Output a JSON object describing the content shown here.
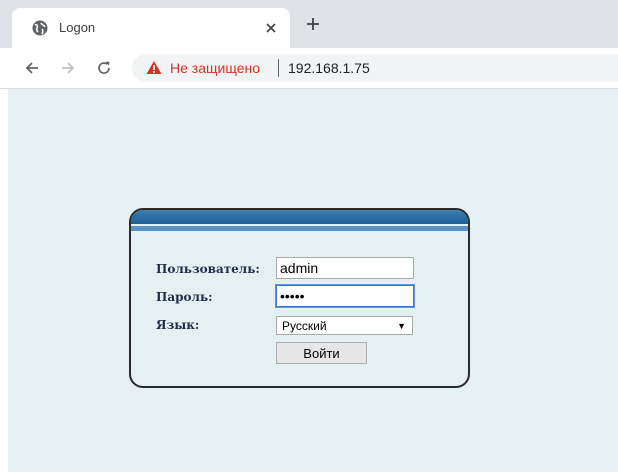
{
  "browser": {
    "tab": {
      "title": "Logon",
      "favicon": "globe-icon",
      "close_icon": "close-icon"
    },
    "new_tab_icon": "plus-icon",
    "nav": {
      "back_icon": "arrow-left-icon",
      "forward_icon": "arrow-right-icon",
      "reload_icon": "reload-icon"
    },
    "address_bar": {
      "security_icon": "warning-icon",
      "security_text": "Не защищено",
      "url": "192.168.1.75"
    },
    "colors": {
      "warning": "#d93025",
      "tabstrip": "#dee1e6"
    }
  },
  "login_form": {
    "username_label": "Пользователь:",
    "username_value": "admin",
    "password_label": "Пароль:",
    "password_value": "•••••",
    "language_label": "Язык:",
    "language_selected": "Русский",
    "submit_label": "Войти",
    "colors": {
      "page_background": "#e5f0f3",
      "header_blue": "#1f5f94",
      "label_text": "#1e2d4a"
    }
  }
}
